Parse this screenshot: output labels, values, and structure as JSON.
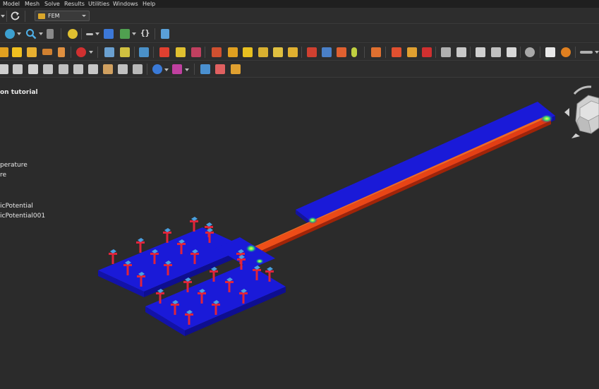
{
  "menu": {
    "items": [
      {
        "label": "Model",
        "accel": "M"
      },
      {
        "label": "Mesh",
        "accel": "M"
      },
      {
        "label": "Solve",
        "accel": "S"
      },
      {
        "label": "Results",
        "accel": "R"
      },
      {
        "label": "Utilities",
        "accel": "U"
      },
      {
        "label": "Windows",
        "accel": "W"
      },
      {
        "label": "Help",
        "accel": "H"
      }
    ]
  },
  "workbench": {
    "label": "FEM",
    "icon": "fem-workbench-icon"
  },
  "toolbar": {
    "macro_label": "{}"
  },
  "overlay": {
    "title": "on tutorial",
    "lines": [
      "perature",
      "re",
      "",
      "",
      "icPotential",
      "icPotential001"
    ]
  },
  "colors": {
    "plate": "#1a1ad8",
    "hot_strip": "#e03a12",
    "constraint_red": "#e0243a",
    "constraint_blue": "#4aa0e0",
    "background": "#2b2b2b"
  }
}
